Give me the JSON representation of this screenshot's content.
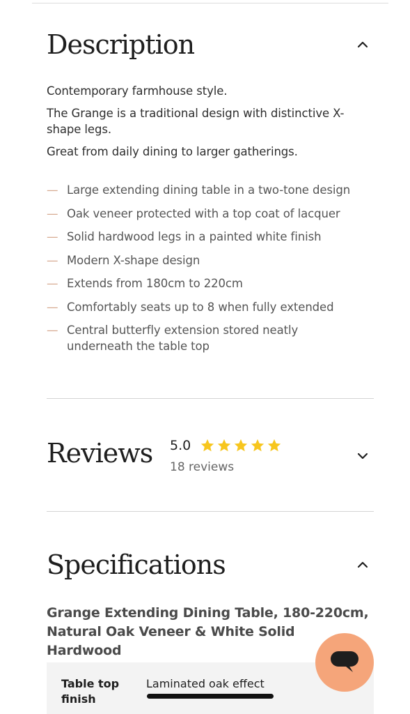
{
  "description": {
    "title": "Description",
    "toggle_icon": "chevron-up-icon",
    "paragraphs": [
      "Contemporary farmhouse style.",
      "The Grange is a traditional design with distinctive X-shape legs.",
      "Great from daily dining to larger gatherings."
    ],
    "bullet_marker": "—",
    "bullets": [
      "Large extending dining table in a two-tone design",
      "Oak veneer protected with a top coat of lacquer",
      "Solid hardwood legs in a painted white finish",
      "Modern X-shape design",
      "Extends from 180cm to 220cm",
      "Comfortably seats up to 8 when fully extended",
      "Central butterfly extension stored neatly underneath the table top"
    ]
  },
  "reviews": {
    "title": "Reviews",
    "rating": "5.0",
    "stars": 5,
    "count_label": "18 reviews",
    "toggle_icon": "chevron-down-icon"
  },
  "specifications": {
    "title": "Specifications",
    "toggle_icon": "chevron-up-icon",
    "product_name": "Grange Extending Dining Table, 180-220cm, Natural Oak Veneer & White Solid Hardwood",
    "rows": [
      {
        "key": "Table top finish",
        "value": "Laminated oak effect"
      }
    ]
  },
  "chat": {
    "icon": "chat-bubble-icon"
  },
  "colors": {
    "accent": "#f5a57a",
    "star": "#f7c61e",
    "bullet_dash": "#d6a88e",
    "spec_table_bg": "#f3f3f3"
  }
}
